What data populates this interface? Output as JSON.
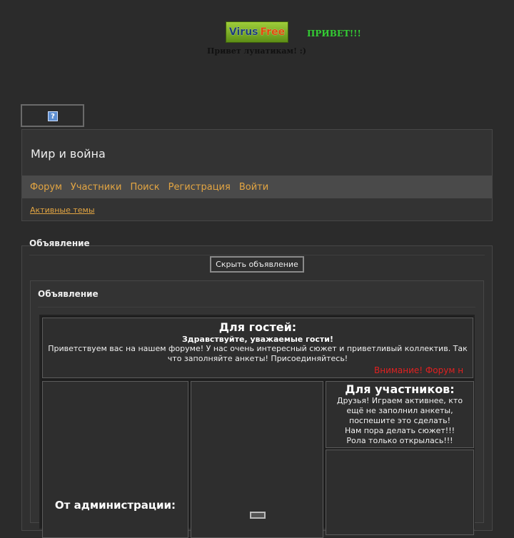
{
  "banner": {
    "virus_word": "Virus",
    "free_word": "Free",
    "privet": "ПРИВЕТ!!!",
    "privet_lunatics": "Привет лунатикам! :)"
  },
  "help": {
    "icon": "?"
  },
  "header": {
    "title": "Мир и война",
    "nav": [
      "Форум",
      "Участники",
      "Поиск",
      "Регистрация",
      "Войти"
    ],
    "active_topics": "Активные темы"
  },
  "announcement": {
    "heading": "Объявление",
    "hide_button": "Скрыть объявление",
    "inner_title": "Объявление",
    "guests": {
      "title": "Для гостей:",
      "greeting": "Здравствуйте, уважаемые гости!",
      "body": "Приветствуем вас на нашем форуме! У нас очень интересный сюжет и приветливый коллектив. Так что заполняйте анкеты! Присоединяйтесь!",
      "marquee": "Внимание! Форум н"
    },
    "admin": {
      "title": "От администрации:"
    },
    "members": {
      "title": "Для участников:",
      "line1": "Друзья! Играем активнее, кто ещё не заполнил анкеты, поспешите это сделать!",
      "line2": "Нам пора делать сюжет!!!",
      "line3": "Рола только открылась!!!"
    }
  },
  "colors": {
    "background": "#2b2b2b",
    "link": "#e3a542",
    "privet": "#33cc33",
    "alert": "#e02020"
  }
}
